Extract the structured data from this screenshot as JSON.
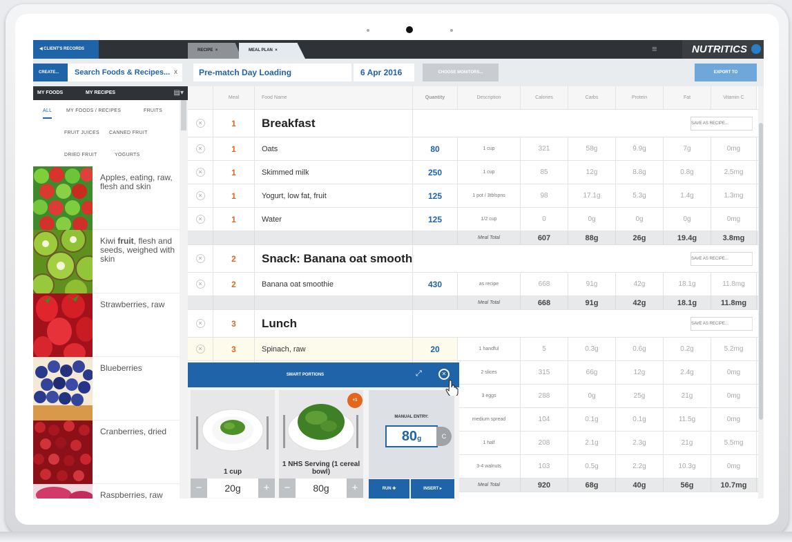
{
  "topbar": {
    "client_records": "◀ CLIENT'S RECORDS",
    "tabs": [
      {
        "label": "RECIPE",
        "close": "×"
      },
      {
        "label": "MEAL PLAN",
        "close": "×"
      }
    ],
    "menu_icon": "hamburger-menu-icon",
    "brand": "NUTRITICS"
  },
  "left_panel": {
    "create_label": "CREATE...",
    "search_value": "Search Foods & Recipes...",
    "search_clear": "x",
    "tabs": [
      "MY FOODS",
      "MY RECIPES"
    ],
    "filter_icon": "filter-icon",
    "filters": [
      "ALL",
      "MY FOODS / RECIPES",
      "FRUITS",
      "FRUIT JUICES",
      "CANNED FRUIT",
      "DRIED FRUIT",
      "YOGURTS"
    ],
    "active_filter": "ALL",
    "foods": [
      {
        "name_pre": "Apples, eating, raw, flesh and skin",
        "bold": "",
        "name_post": ""
      },
      {
        "name_pre": "Kiwi ",
        "bold": "fruit",
        "name_post": ", flesh and seeds, weighed with skin"
      },
      {
        "name_pre": "Strawberries, raw",
        "bold": "",
        "name_post": ""
      },
      {
        "name_pre": "Blueberries",
        "bold": "",
        "name_post": ""
      },
      {
        "name_pre": "Cranberries, dried",
        "bold": "",
        "name_post": ""
      },
      {
        "name_pre": "Raspberries, raw",
        "bold": "",
        "name_post": ""
      }
    ]
  },
  "plan": {
    "name": "Pre-match Day Loading",
    "date": "6 Apr 2016",
    "choose_monitors": "CHOOSE MONITORS...",
    "export": "EXPORT TO"
  },
  "grid": {
    "headers": [
      "Meal",
      "Food Name",
      "Quantity",
      "Description",
      "Calories",
      "Carbs",
      "Protein",
      "Fat",
      "Vitamin C"
    ],
    "save_as_recipe": "SAVE AS RECIPE...",
    "remove_icon": "×",
    "meal_total_label": "Meal Total",
    "sections": [
      {
        "meal": "1",
        "title": "Breakfast",
        "rows": [
          {
            "meal": "1",
            "food": "Oats",
            "qty": "80",
            "desc": "1 cup",
            "vals": [
              "321",
              "58g",
              "9.9g",
              "7g",
              "0mg"
            ]
          },
          {
            "meal": "1",
            "food": "Skimmed milk",
            "qty": "250",
            "desc": "1 cup",
            "vals": [
              "85",
              "12g",
              "8.8g",
              "0.8g",
              "2.5mg"
            ]
          },
          {
            "meal": "1",
            "food": "Yogurt, low fat, fruit",
            "qty": "125",
            "desc": "1 pot / 3tblspns",
            "vals": [
              "98",
              "17.1g",
              "5.3g",
              "1.4g",
              "1.3mg"
            ]
          },
          {
            "meal": "1",
            "food": "Water",
            "qty": "125",
            "desc": "1/2 cup",
            "vals": [
              "0",
              "0g",
              "0g",
              "0g",
              "0mg"
            ]
          }
        ],
        "total": [
          "607",
          "88g",
          "26g",
          "19.4g",
          "3.8mg"
        ]
      },
      {
        "meal": "2",
        "title": "Snack: Banana oat smoothie",
        "rows": [
          {
            "meal": "2",
            "food": "Banana oat smoothie",
            "qty": "430",
            "desc": "as recipe",
            "vals": [
              "668",
              "91g",
              "42g",
              "18.1g",
              "11.8mg"
            ]
          }
        ],
        "total": [
          "668",
          "91g",
          "42g",
          "18.1g",
          "11.8mg"
        ]
      },
      {
        "meal": "3",
        "title": "Lunch",
        "rows": [
          {
            "meal": "3",
            "food": "Spinach, raw",
            "qty": "20",
            "desc": "1 handful",
            "vals": [
              "5",
              "0.3g",
              "0.6g",
              "0.2g",
              "5.2mg"
            ]
          },
          {
            "meal": "",
            "food": "",
            "qty": "",
            "desc": "2 slices",
            "vals": [
              "315",
              "66g",
              "12g",
              "2.4g",
              "0mg"
            ]
          },
          {
            "meal": "",
            "food": "",
            "qty": "",
            "desc": "3 eggs",
            "vals": [
              "288",
              "0g",
              "25g",
              "21g",
              "0mg"
            ]
          },
          {
            "meal": "",
            "food": "",
            "qty": "",
            "desc": "medium spread",
            "vals": [
              "104",
              "0.1g",
              "0.1g",
              "11.5g",
              "0mg"
            ]
          },
          {
            "meal": "",
            "food": "",
            "qty": "",
            "desc": "1 half",
            "vals": [
              "208",
              "2.1g",
              "2.3g",
              "21g",
              "5.5mg"
            ]
          },
          {
            "meal": "",
            "food": "",
            "qty": "",
            "desc": "3-4 walnuts",
            "vals": [
              "103",
              "0.5g",
              "2.2g",
              "10.3g",
              "0mg"
            ]
          }
        ],
        "total": [
          "920",
          "68g",
          "40g",
          "56g",
          "10.7mg"
        ]
      }
    ]
  },
  "smart_portions": {
    "title": "SMART PORTIONS",
    "expand_icon": "expand-icon",
    "close_icon": "close-icon",
    "portions": [
      {
        "label": "1 cup",
        "value": "20g"
      },
      {
        "label": "1 NHS Serving (1 cereal bowl)",
        "value": "80g",
        "badge": "+1"
      }
    ],
    "manual_label": "MANUAL ENTRY:",
    "manual_value": "80",
    "manual_unit": "g",
    "unit_toggle": "C",
    "minus": "−",
    "plus": "+",
    "run_label": "RUN ✚",
    "insert_label": "INSERT ▸"
  },
  "colors": {
    "accent": "#1f63a8",
    "meal_number": "#e4661d",
    "topbar": "#2f3237"
  }
}
